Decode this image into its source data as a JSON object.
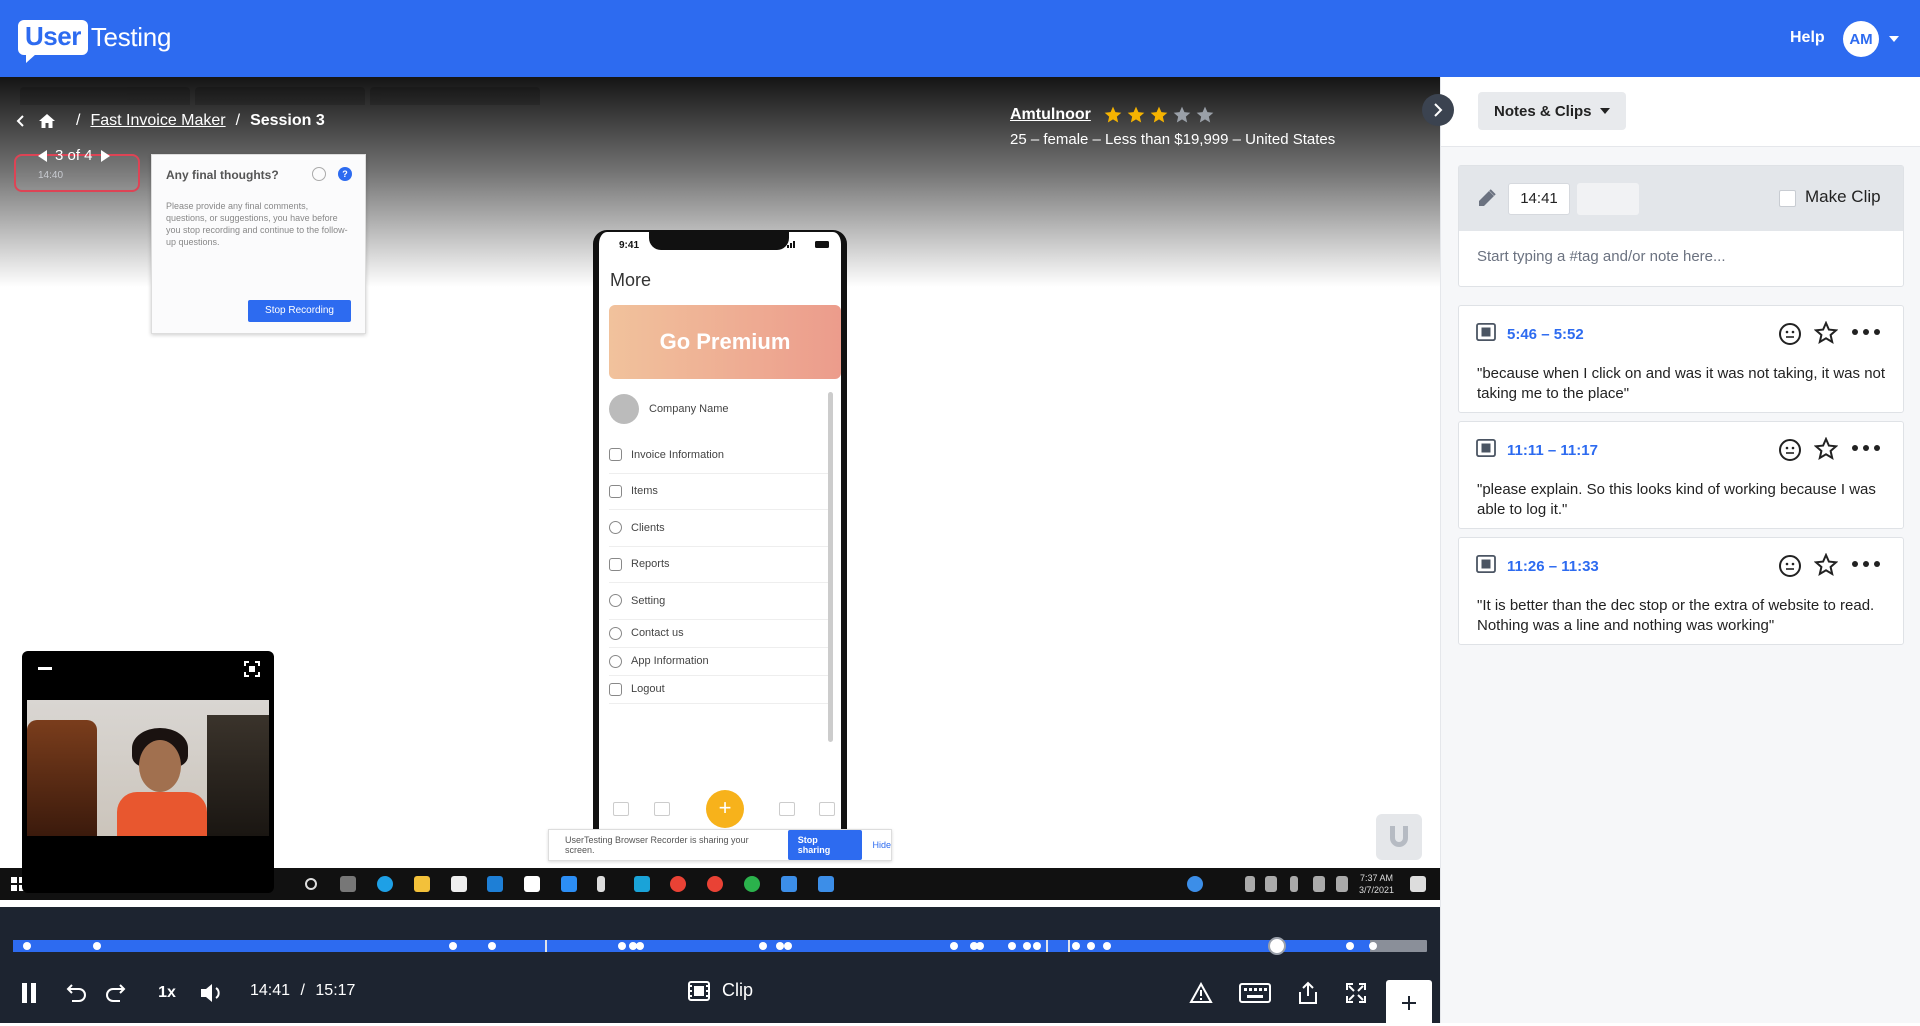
{
  "brand": {
    "logo_box": "User",
    "logo_rest": "Testing"
  },
  "header": {
    "help_label": "Help",
    "avatar_initials": "AM"
  },
  "breadcrumb": {
    "project": "Fast Invoice Maker",
    "session": "Session 3"
  },
  "participant": {
    "name": "Amtulnoor",
    "rating": 3,
    "rating_max": 5,
    "demographics": "25 – female – Less than $19,999 – United States"
  },
  "task_widget": {
    "counter": "3 of 4",
    "mini_time": "14:40"
  },
  "recording_card": {
    "title": "Any final thoughts?",
    "body": "Please provide any final comments, questions, or suggestions, you have before you stop recording and continue to the follow-up questions.",
    "stop_button": "Stop Recording"
  },
  "phone": {
    "status_time": "9:41",
    "screen_title": "More",
    "premium_label": "Go Premium",
    "company": "Company Name",
    "menu": [
      "Invoice Information",
      "Items",
      "Clients",
      "Reports",
      "Setting",
      "Contact us",
      "App Information",
      "Logout"
    ]
  },
  "share_bar": {
    "text": "UserTesting Browser Recorder is sharing your screen.",
    "stop_label": "Stop sharing",
    "hide_label": "Hide"
  },
  "taskbar": {
    "clock_time": "7:37 AM",
    "clock_date": "3/7/2021"
  },
  "player": {
    "speed": "1x",
    "current_time": "14:41",
    "separator": "/",
    "total_time": "15:17",
    "clip_label": "Clip",
    "progress_fraction": 0.96
  },
  "panel": {
    "dropdown_label": "Notes & Clips",
    "note": {
      "timestamp": "14:41",
      "make_clip_label": "Make Clip",
      "placeholder": "Start typing a #tag and/or note here..."
    },
    "clips": [
      {
        "range": "5:46 – 5:52",
        "quote": "\"because when I click on and was it was not taking, it was not taking me to the place\""
      },
      {
        "range": "11:11 – 11:17",
        "quote": "\"please explain. So this looks kind of working because I was able to log it.\""
      },
      {
        "range": "11:26 – 11:33",
        "quote": "\"It is better than the dec stop or the extra of website to read. Nothing was a line and nothing was working\""
      }
    ]
  },
  "colors": {
    "brand_blue": "#2d6bf0",
    "control_bar": "#1d2430",
    "star_gold": "#f5b301"
  }
}
